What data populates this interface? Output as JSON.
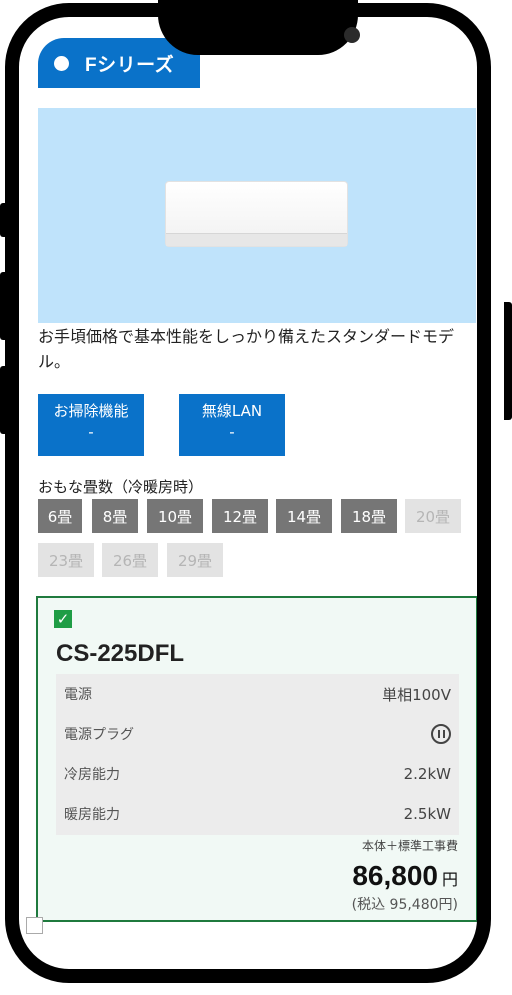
{
  "series": {
    "label": "Fシリーズ"
  },
  "description": "お手頃価格で基本性能をしっかり備えたスタンダードモデル。",
  "features": [
    {
      "label": "お掃除機能",
      "value": "-"
    },
    {
      "label": "無線LAN",
      "value": "-"
    }
  ],
  "tatami": {
    "title": "おもな畳数（冷暖房時）",
    "options": [
      {
        "label": "6畳",
        "active": true
      },
      {
        "label": "8畳",
        "active": true
      },
      {
        "label": "10畳",
        "active": true
      },
      {
        "label": "12畳",
        "active": true
      },
      {
        "label": "14畳",
        "active": true
      },
      {
        "label": "18畳",
        "active": true
      },
      {
        "label": "20畳",
        "active": false
      },
      {
        "label": "23畳",
        "active": false
      },
      {
        "label": "26畳",
        "active": false
      },
      {
        "label": "29畳",
        "active": false
      }
    ]
  },
  "product": {
    "checked_mark": "✓",
    "model": "CS-225DFL",
    "specs": [
      {
        "key": "電源",
        "value": "単相100V"
      },
      {
        "key": "電源プラグ",
        "value": ""
      },
      {
        "key": "冷房能力",
        "value": "2.2kW"
      },
      {
        "key": "暖房能力",
        "value": "2.5kW"
      }
    ],
    "install_note": "本体＋標準工事費",
    "price": "86,800",
    "price_unit": "円",
    "tax_included": "(税込 95,480円)"
  },
  "colors": {
    "accent": "#0a72c9",
    "selected_border": "#1f7a3e",
    "check": "#1f9d45"
  }
}
